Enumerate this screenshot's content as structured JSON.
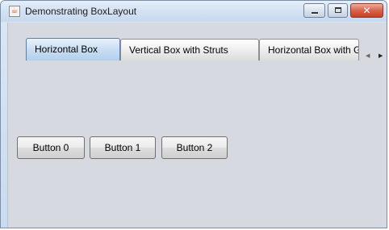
{
  "window": {
    "title": "Demonstrating BoxLayout",
    "app_icon": "java-app-icon",
    "controls": {
      "minimize": "minimize-icon",
      "maximize": "maximize-icon",
      "close": "close-icon",
      "close_glyph": "✕"
    }
  },
  "tabs": [
    {
      "label": "Horizontal Box",
      "selected": true
    },
    {
      "label": "Vertical Box with Struts",
      "selected": false
    },
    {
      "label": "Horizontal Box with Glue",
      "selected": false
    }
  ],
  "tab_scroll": {
    "left": "◀",
    "right": "▶"
  },
  "buttons": [
    {
      "label": "Button 0"
    },
    {
      "label": "Button 1"
    },
    {
      "label": "Button 2"
    }
  ],
  "colors": {
    "panel_background": "#d6d9df",
    "selected_tab": "#c6dcf2",
    "close_button": "#c9452c"
  }
}
